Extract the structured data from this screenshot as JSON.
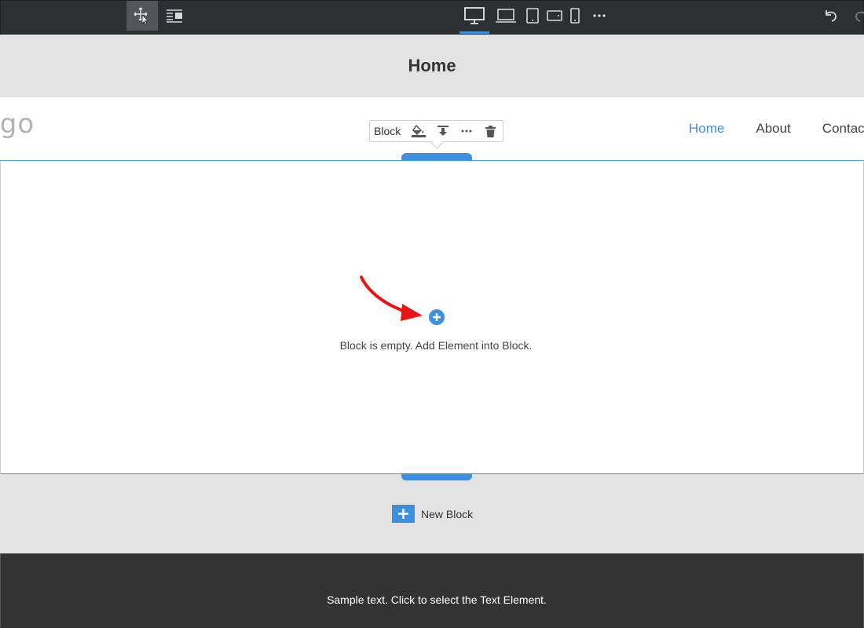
{
  "toolbar": {
    "modes": [
      {
        "name": "select-mode",
        "icon": "move-cursor-icon",
        "active": true
      },
      {
        "name": "layers-mode",
        "icon": "layers-icon",
        "active": false
      }
    ],
    "devices": [
      {
        "name": "desktop",
        "icon": "desktop-icon",
        "active": true
      },
      {
        "name": "laptop",
        "icon": "laptop-icon"
      },
      {
        "name": "tablet",
        "icon": "tablet-icon"
      },
      {
        "name": "tablet-landscape",
        "icon": "tablet-landscape-icon"
      },
      {
        "name": "phone",
        "icon": "phone-icon"
      },
      {
        "name": "more",
        "icon": "ellipsis-icon"
      }
    ],
    "history": [
      {
        "name": "undo",
        "icon": "undo-icon"
      },
      {
        "name": "redo",
        "icon": "redo-icon"
      }
    ]
  },
  "page": {
    "title": "Home"
  },
  "header": {
    "logo_text": "ogo",
    "nav": [
      "Home",
      "About",
      "Contac"
    ],
    "nav_active_index": 0
  },
  "block_toolbar": {
    "label": "Block",
    "actions": [
      {
        "name": "fill",
        "icon": "paint-bucket-icon"
      },
      {
        "name": "insert",
        "icon": "download-icon"
      },
      {
        "name": "more",
        "icon": "ellipsis-icon"
      },
      {
        "name": "delete",
        "icon": "trash-icon"
      }
    ]
  },
  "block": {
    "empty_message": "Block is empty. Add Element into Block."
  },
  "new_block": {
    "label": "New Block"
  },
  "footer": {
    "text": "Sample text. Click to select the Text Element."
  },
  "colors": {
    "accent": "#3d8fe0",
    "toolbar_bg": "#2d3033",
    "canvas_bg": "#e3e3e3",
    "footer_bg": "#333333",
    "arrow": "#e81515",
    "nav_active": "#3d8fd6"
  }
}
